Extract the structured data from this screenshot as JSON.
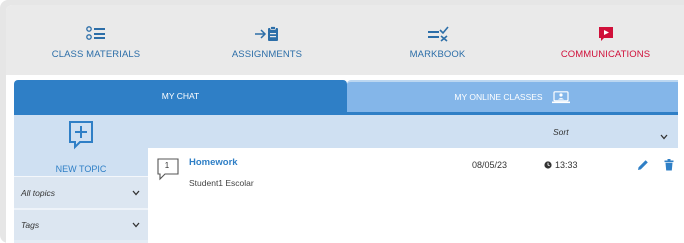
{
  "nav": {
    "items": [
      {
        "label": "CLASS MATERIALS",
        "icon": "list-icon"
      },
      {
        "label": "ASSIGNMENTS",
        "icon": "clipboard-arrow-icon"
      },
      {
        "label": "MARKBOOK",
        "icon": "equals-check-icon"
      },
      {
        "label": "COMMUNICATIONS",
        "icon": "play-message-icon"
      }
    ]
  },
  "tabs": {
    "my_chat": "MY CHAT",
    "my_online_classes": "MY ONLINE CLASSES"
  },
  "sidebar": {
    "new_topic": "NEW TOPIC",
    "filters": [
      {
        "label": "All topics"
      },
      {
        "label": "Tags"
      }
    ]
  },
  "list": {
    "sort_label": "Sort",
    "rows": [
      {
        "count": "1",
        "title": "Homework",
        "author": "Student1 Escolar",
        "date": "08/05/23",
        "time": "13:33"
      }
    ]
  },
  "colors": {
    "primary_blue": "#2f7fc6",
    "light_blue": "#84b6e9",
    "communications_red": "#d0103a"
  }
}
